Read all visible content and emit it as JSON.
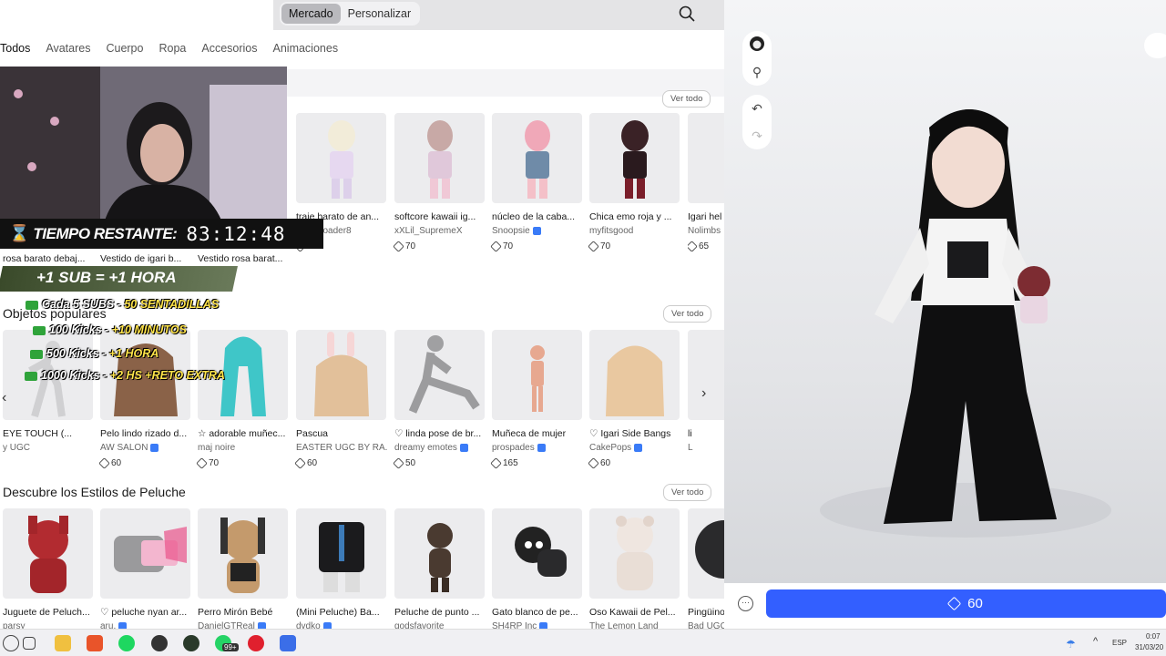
{
  "topbar": {
    "tab_market": "Mercado",
    "tab_customize": "Personalizar"
  },
  "tabs": [
    "Todos",
    "Avatares",
    "Cuerpo",
    "Ropa",
    "Accesorios",
    "Animaciones"
  ],
  "ver_todo": "Ver todo",
  "row1": [
    {
      "name": "rosa barato debaj...",
      "creator": "",
      "price": ""
    },
    {
      "name": "Vestido de igari b...",
      "creator": "",
      "price": ""
    },
    {
      "name": "Vestido rosa barat...",
      "creator": "",
      "price": ""
    },
    {
      "name": "traje barato de an...",
      "creator": "vueuploader8",
      "price": "70"
    },
    {
      "name": "softcore kawaii ig...",
      "creator": "xXLil_SupremeX",
      "price": "70"
    },
    {
      "name": "núcleo de la caba...",
      "creator": "Snoopsie",
      "price": "70"
    },
    {
      "name": "Chica emo roja y ...",
      "creator": "myfitsgood",
      "price": "70"
    },
    {
      "name": "Igari hel",
      "creator": "Nolimbs",
      "price": "65"
    }
  ],
  "section_popular": "Objetos populares",
  "row2": [
    {
      "name": "EYE TOUCH (...",
      "creator": "y UGC",
      "price": ""
    },
    {
      "name": "Pelo lindo rizado d...",
      "creator": "AW SALON",
      "price": "60"
    },
    {
      "name": "☆ adorable muñec...",
      "creator": "maj noire",
      "price": "70"
    },
    {
      "name": "Pascua",
      "creator": "EASTER UGC BY RA...",
      "price": "60"
    },
    {
      "name": "♡ linda pose de br...",
      "creator": "dreamy emotes",
      "price": "50"
    },
    {
      "name": "Muñeca de mujer",
      "creator": "prospades",
      "price": "165"
    },
    {
      "name": "♡ Igari Side Bangs",
      "creator": "CakePops",
      "price": "60"
    },
    {
      "name": "li",
      "creator": "L",
      "price": ""
    }
  ],
  "section_plush": "Descubre los Estilos de Peluche",
  "row3": [
    {
      "name": "Juguete de Peluch...",
      "creator": "parsy"
    },
    {
      "name": "♡ peluche nyan ar...",
      "creator": "aru."
    },
    {
      "name": "Perro Mirón Bebé",
      "creator": "DanielGTReal"
    },
    {
      "name": "(Mini Peluche) Ba...",
      "creator": "dvdko"
    },
    {
      "name": "Peluche de punto ...",
      "creator": "godsfavorite"
    },
    {
      "name": "Gato blanco de pe...",
      "creator": "SH4RP Inc"
    },
    {
      "name": "Oso Kawaii de Pel...",
      "creator": "The Lemon Land"
    },
    {
      "name": "Pingüino",
      "creator": "Bad UGC"
    }
  ],
  "overlay": {
    "timer_label": "TIEMPO RESTANTE:",
    "timer_value": "83:12:48",
    "sub": "+1 SUB = +1 HORA",
    "promos": [
      {
        "a": "Cada 5 SUBS - ",
        "b": "50 SENTADILLAS"
      },
      {
        "a": "100 Kicks - ",
        "b": "+10 MINUTOS"
      },
      {
        "a": "500 Kicks - ",
        "b": "+1 HORA"
      },
      {
        "a": "1000 Kicks - ",
        "b": "+2 HS +RETO EXTRA"
      }
    ]
  },
  "editor": {
    "price": "60",
    "undo": "↶",
    "redo": "↷"
  },
  "taskbar": {
    "lang": "ESP",
    "time": "0:07",
    "date": "31/03/20",
    "badge": "99+"
  },
  "colors": {
    "accent": "#335fff",
    "verified": "#3a7bf7"
  }
}
